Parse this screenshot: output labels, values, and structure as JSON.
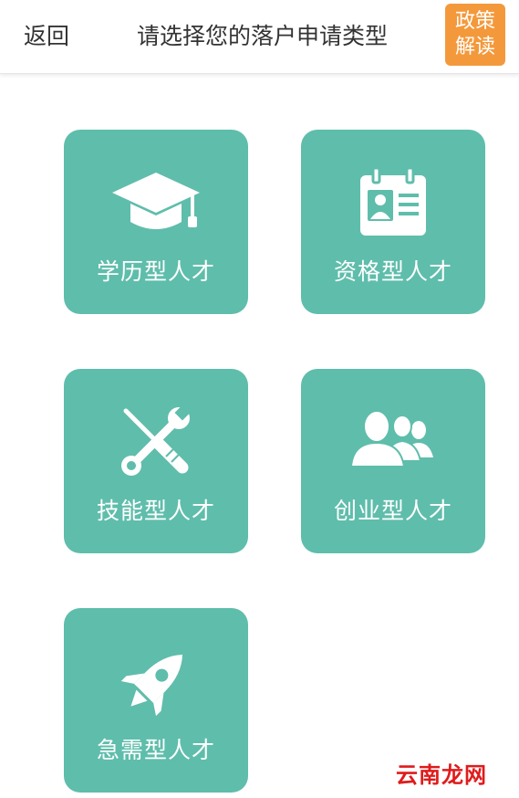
{
  "header": {
    "back_label": "返回",
    "title": "请选择您的落户申请类型",
    "policy_line1": "政策",
    "policy_line2": "解读"
  },
  "categories": [
    {
      "label": "学历型人才",
      "icon": "graduation-cap-icon"
    },
    {
      "label": "资格型人才",
      "icon": "id-badge-icon"
    },
    {
      "label": "技能型人才",
      "icon": "wrench-screwdriver-icon"
    },
    {
      "label": "创业型人才",
      "icon": "people-group-icon"
    },
    {
      "label": "急需型人才",
      "icon": "rocket-icon"
    }
  ],
  "watermark": "云南龙网",
  "colors": {
    "card": "#5fbdab",
    "policy_button": "#f4993b",
    "watermark": "#e01b1b"
  }
}
